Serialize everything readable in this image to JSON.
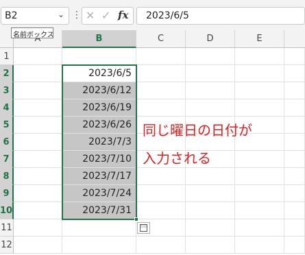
{
  "namebox": {
    "value": "B2",
    "tooltip": "名前ボックス"
  },
  "formula_bar": {
    "fx_label": "fx",
    "value": "2023/6/5"
  },
  "columns": [
    "A",
    "B",
    "C",
    "D",
    "E"
  ],
  "rows": [
    "1",
    "2",
    "3",
    "4",
    "5",
    "6",
    "7",
    "8",
    "9",
    "10",
    "11",
    "12"
  ],
  "cells_B": [
    "",
    "2023/6/5",
    "2023/6/12",
    "2023/6/19",
    "2023/6/26",
    "2023/7/3",
    "2023/7/10",
    "2023/7/17",
    "2023/7/24",
    "2023/7/31",
    "",
    ""
  ],
  "annotation": {
    "line1": "同じ曜日の日付が",
    "line2": "入力される"
  },
  "colors": {
    "selection": "#217346",
    "annotation": "#e02020",
    "fill": "#c6c6c6"
  }
}
